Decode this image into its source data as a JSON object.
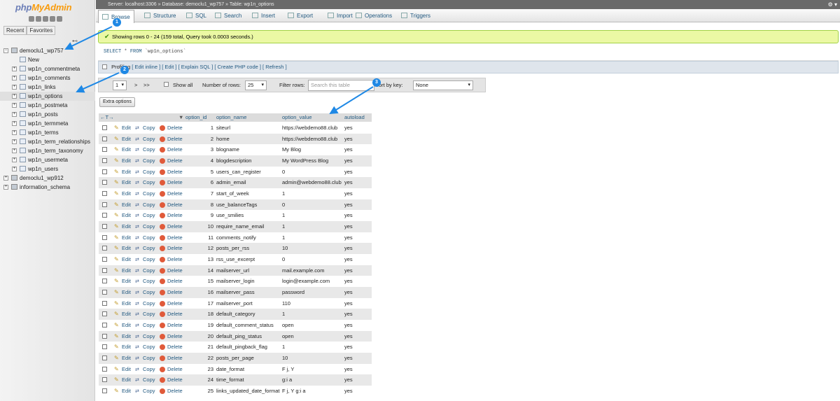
{
  "app": {
    "logo_php": "php",
    "logo_admin": "MyAdmin",
    "recent": "Recent",
    "favorites": "Favorites"
  },
  "breadcrumb": {
    "server": "Server: localhost:3306",
    "database": "Database: democlu1_wp757",
    "table": "Table: wp1n_options"
  },
  "tree": {
    "db1": "democlu1_wp757",
    "new": "New",
    "tables": [
      "wp1n_commentmeta",
      "wp1n_comments",
      "wp1n_links",
      "wp1n_options",
      "wp1n_postmeta",
      "wp1n_posts",
      "wp1n_termmeta",
      "wp1n_terms",
      "wp1n_term_relationships",
      "wp1n_term_taxonomy",
      "wp1n_usermeta",
      "wp1n_users"
    ],
    "db2": "democlu1_wp912",
    "db3": "information_schema"
  },
  "tabs": [
    "Browse",
    "Structure",
    "SQL",
    "Search",
    "Insert",
    "Export",
    "Import",
    "Operations",
    "Triggers"
  ],
  "success": "Showing rows 0 - 24 (159 total, Query took 0.0003 seconds.)",
  "sql": {
    "select": "SELECT",
    "star": "*",
    "from": "FROM",
    "table": "`wp1n_options`"
  },
  "profiling": {
    "label": "Profiling",
    "links": "[ Edit inline ] [ Edit ] [ Explain SQL ] [ Create PHP code ] [ Refresh ]"
  },
  "nav": {
    "page": "1",
    "next": ">",
    "last": ">>",
    "show_all": "Show all",
    "rows_label": "Number of rows:",
    "rows": "25",
    "filter_label": "Filter rows:",
    "filter_placeholder": "Search this table",
    "sort_label": "Sort by key:",
    "sort_value": "None"
  },
  "extra_options": "Extra options",
  "columns": {
    "arrows": "←T→",
    "option_id": "option_id",
    "option_name": "option_name",
    "option_value": "option_value",
    "autoload": "autoload"
  },
  "actions": {
    "edit": "Edit",
    "copy": "Copy",
    "delete": "Delete"
  },
  "rows": [
    {
      "id": "1",
      "name": "siteurl",
      "value": "https://webdemo88.club",
      "autoload": "yes"
    },
    {
      "id": "2",
      "name": "home",
      "value": "https://webdemo88.club",
      "autoload": "yes"
    },
    {
      "id": "3",
      "name": "blogname",
      "value": "My Blog",
      "autoload": "yes"
    },
    {
      "id": "4",
      "name": "blogdescription",
      "value": "My WordPress Blog",
      "autoload": "yes"
    },
    {
      "id": "5",
      "name": "users_can_register",
      "value": "0",
      "autoload": "yes"
    },
    {
      "id": "6",
      "name": "admin_email",
      "value": "admin@webdemo88.club",
      "autoload": "yes"
    },
    {
      "id": "7",
      "name": "start_of_week",
      "value": "1",
      "autoload": "yes"
    },
    {
      "id": "8",
      "name": "use_balanceTags",
      "value": "0",
      "autoload": "yes"
    },
    {
      "id": "9",
      "name": "use_smilies",
      "value": "1",
      "autoload": "yes"
    },
    {
      "id": "10",
      "name": "require_name_email",
      "value": "1",
      "autoload": "yes"
    },
    {
      "id": "11",
      "name": "comments_notify",
      "value": "1",
      "autoload": "yes"
    },
    {
      "id": "12",
      "name": "posts_per_rss",
      "value": "10",
      "autoload": "yes"
    },
    {
      "id": "13",
      "name": "rss_use_excerpt",
      "value": "0",
      "autoload": "yes"
    },
    {
      "id": "14",
      "name": "mailserver_url",
      "value": "mail.example.com",
      "autoload": "yes"
    },
    {
      "id": "15",
      "name": "mailserver_login",
      "value": "login@example.com",
      "autoload": "yes"
    },
    {
      "id": "16",
      "name": "mailserver_pass",
      "value": "password",
      "autoload": "yes"
    },
    {
      "id": "17",
      "name": "mailserver_port",
      "value": "110",
      "autoload": "yes"
    },
    {
      "id": "18",
      "name": "default_category",
      "value": "1",
      "autoload": "yes"
    },
    {
      "id": "19",
      "name": "default_comment_status",
      "value": "open",
      "autoload": "yes"
    },
    {
      "id": "20",
      "name": "default_ping_status",
      "value": "open",
      "autoload": "yes"
    },
    {
      "id": "21",
      "name": "default_pingback_flag",
      "value": "1",
      "autoload": "yes"
    },
    {
      "id": "22",
      "name": "posts_per_page",
      "value": "10",
      "autoload": "yes"
    },
    {
      "id": "23",
      "name": "date_format",
      "value": "F j, Y",
      "autoload": "yes"
    },
    {
      "id": "24",
      "name": "time_format",
      "value": "g:i a",
      "autoload": "yes"
    },
    {
      "id": "25",
      "name": "links_updated_date_format",
      "value": "F j, Y g:i a",
      "autoload": "yes"
    }
  ],
  "markers": [
    "1",
    "2",
    "3"
  ],
  "colors": {
    "link": "#235a81",
    "success_bg": "#ebf8a4",
    "arrow": "#1e88e5"
  }
}
